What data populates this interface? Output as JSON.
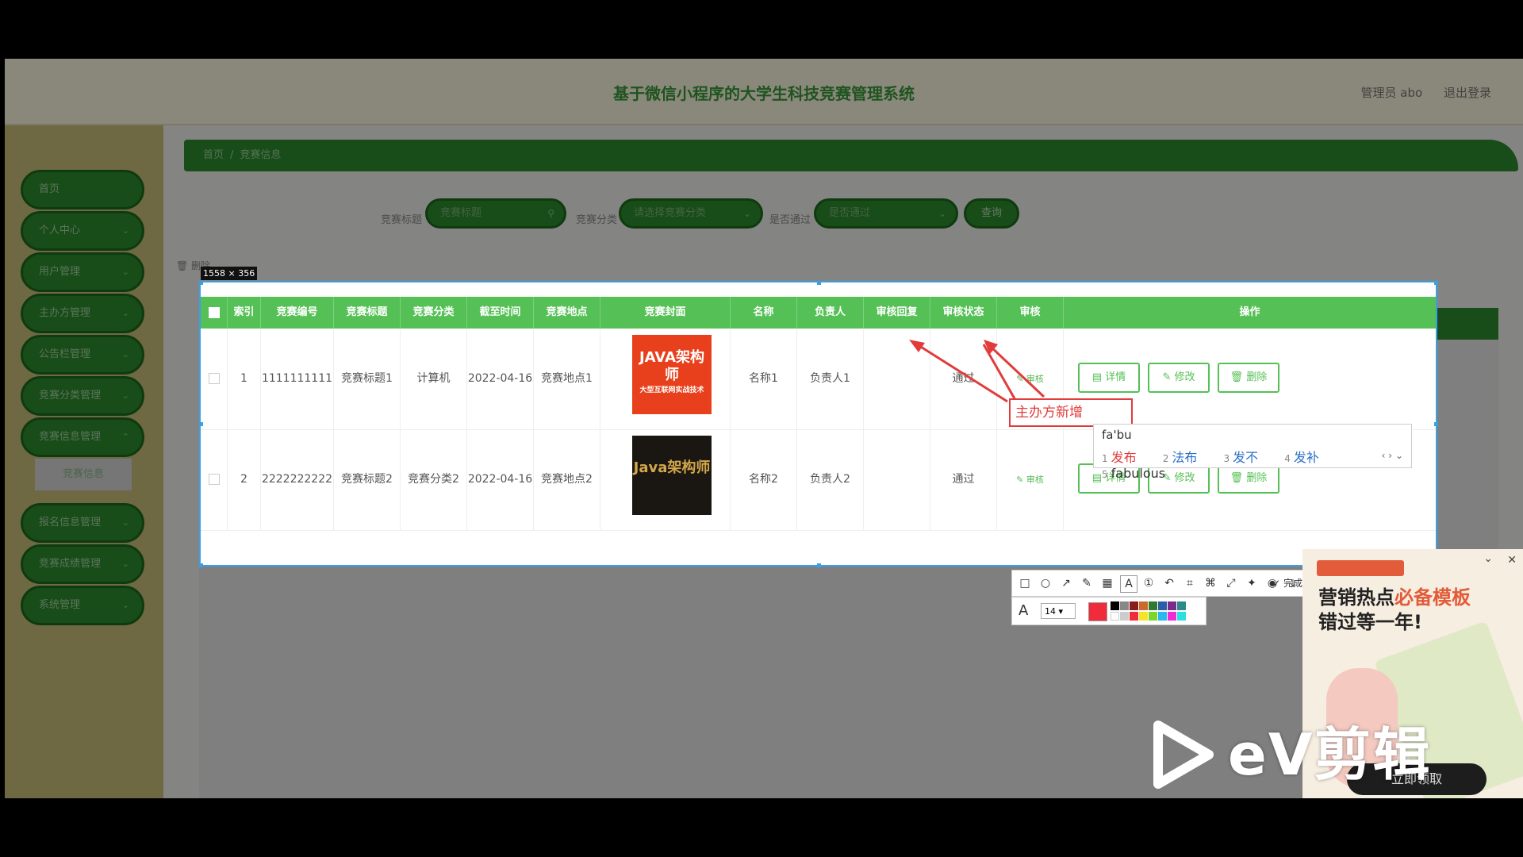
{
  "app": {
    "title": "基于微信小程序的大学生科技竞赛管理系统",
    "user": "管理员 abo",
    "logout": "退出登录"
  },
  "sidebar": {
    "items": [
      {
        "label": "首页"
      },
      {
        "label": "个人中心"
      },
      {
        "label": "用户管理"
      },
      {
        "label": "主办方管理"
      },
      {
        "label": "公告栏管理"
      },
      {
        "label": "竞赛分类管理"
      },
      {
        "label": "竞赛信息管理"
      },
      {
        "label": "报名信息管理"
      },
      {
        "label": "竞赛成绩管理"
      },
      {
        "label": "系统管理"
      }
    ],
    "sub_item": "竞赛信息"
  },
  "breadcrumb": {
    "home": "首页",
    "sep": "/",
    "current": "竞赛信息"
  },
  "filters": {
    "title_label": "竞赛标题",
    "title_placeholder": "竞赛标题",
    "category_label": "竞赛分类",
    "category_placeholder": "请选择竞赛分类",
    "approved_label": "是否通过",
    "approved_placeholder": "是否通过",
    "query": "查询",
    "delete": "删除"
  },
  "table": {
    "headers": [
      "索引",
      "竞赛编号",
      "竞赛标题",
      "竞赛分类",
      "截至时间",
      "竞赛地点",
      "竞赛封面",
      "名称",
      "负责人",
      "审核回复",
      "审核状态",
      "审核",
      "操作"
    ],
    "rows": [
      {
        "index": "1",
        "code": "1111111111",
        "title": "竞赛标题1",
        "category": "计算机",
        "deadline": "2022-04-16",
        "place": "竞赛地点1",
        "cover": "JAVA架构师",
        "cover_sub": "大型互联网实战技术",
        "name": "名称1",
        "owner": "负责人1",
        "reply": "",
        "status": "通过",
        "audit": "审核"
      },
      {
        "index": "2",
        "code": "2222222222",
        "title": "竞赛标题2",
        "category": "竞赛分类2",
        "deadline": "2022-04-16",
        "place": "竞赛地点2",
        "cover": "Java架构师",
        "name": "名称2",
        "owner": "负责人2",
        "reply": "",
        "status": "通过",
        "audit": "审核"
      }
    ],
    "detail": "详情",
    "edit": "修改",
    "del": "删除"
  },
  "overlay": {
    "size_badge": "1558 × 356",
    "callout": "主办方新增",
    "ime_comp": "fa'bu",
    "ime_cands": [
      {
        "n": "1",
        "w": "发布"
      },
      {
        "n": "2",
        "w": "法布"
      },
      {
        "n": "3",
        "w": "发不"
      },
      {
        "n": "4",
        "w": "发补"
      },
      {
        "n": "5",
        "w": "fabulous"
      }
    ],
    "done": "完成",
    "font_size": "14"
  },
  "ad": {
    "title_line1_a": "营销热点",
    "title_line1_b": "必备模板",
    "title_line2": "错过等一年!",
    "cta": "立即领取"
  },
  "watermark": "eV剪辑"
}
